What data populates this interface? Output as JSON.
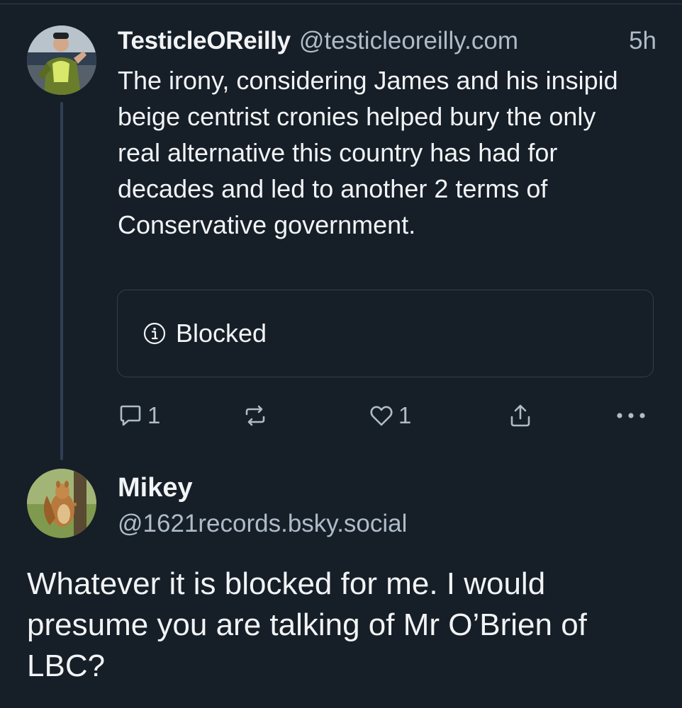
{
  "parent_post": {
    "display_name": "TesticleOReilly",
    "handle": "@testicleoreilly.com",
    "timestamp": "5h",
    "text": "The irony, considering James and his insipid beige centrist cronies helped bury the only real alternative this country has had for decades and led to another 2 terms of Conservative government.",
    "embed": {
      "icon": "info-icon",
      "label": "Blocked"
    },
    "actions": {
      "reply_count": "1",
      "like_count": "1"
    }
  },
  "reply_post": {
    "display_name": "Mikey",
    "handle": "@1621records.bsky.social",
    "text": "Whatever it is blocked for me. I would presume you are talking of Mr O’Brien of LBC?"
  },
  "colors": {
    "background": "#161e27",
    "primary_text": "#f1f3f5",
    "secondary_text": "#aebbc9",
    "border": "#2e4052"
  }
}
